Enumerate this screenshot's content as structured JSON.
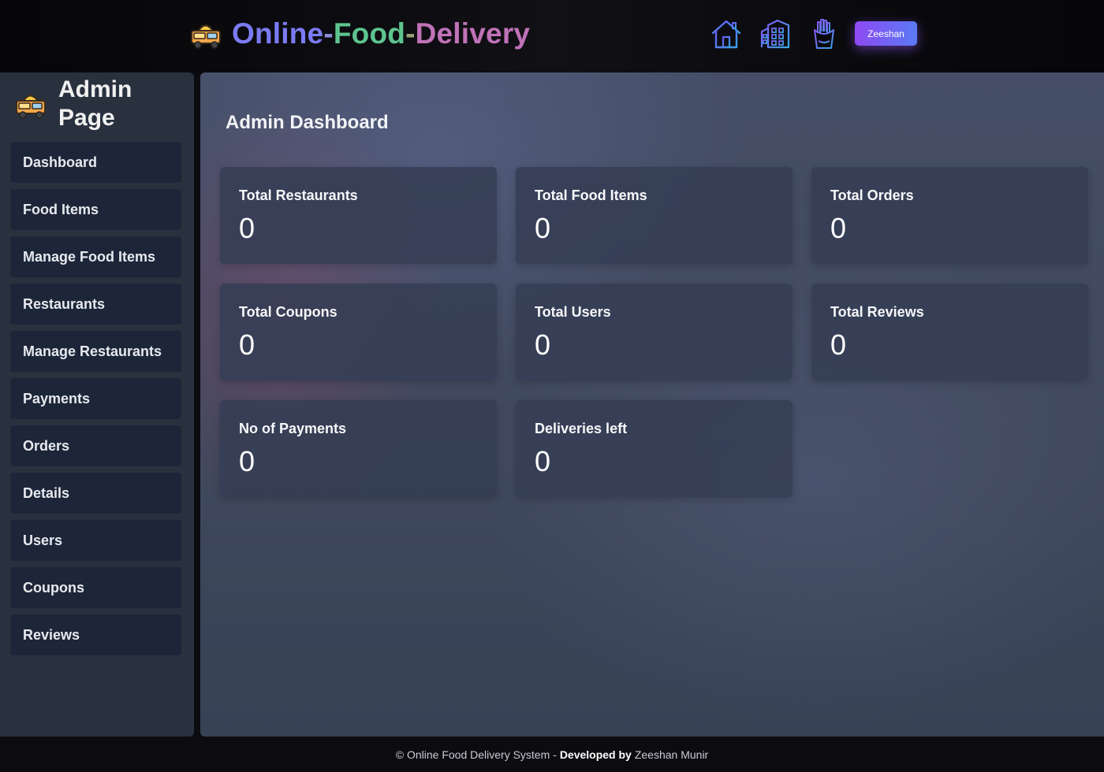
{
  "header": {
    "brand_part1": "Online",
    "brand_dash1": "-",
    "brand_part2": "Food",
    "brand_dash2": "-",
    "brand_part3": "Delivery",
    "nav_icons": [
      "home-icon",
      "restaurants-building-icon",
      "fries-food-icon"
    ],
    "user_button": "Zeeshan"
  },
  "sidebar": {
    "title": "Admin Page",
    "items": [
      {
        "label": "Dashboard"
      },
      {
        "label": "Food Items"
      },
      {
        "label": "Manage Food Items"
      },
      {
        "label": "Restaurants"
      },
      {
        "label": "Manage Restaurants"
      },
      {
        "label": "Payments"
      },
      {
        "label": "Orders"
      },
      {
        "label": "Details"
      },
      {
        "label": "Users"
      },
      {
        "label": "Coupons"
      },
      {
        "label": "Reviews"
      }
    ]
  },
  "main": {
    "title": "Admin Dashboard",
    "cards": [
      {
        "label": "Total Restaurants",
        "value": "0"
      },
      {
        "label": "Total Food Items",
        "value": "0"
      },
      {
        "label": "Total Orders",
        "value": "0"
      },
      {
        "label": "Total Coupons",
        "value": "0"
      },
      {
        "label": "Total Users",
        "value": "0"
      },
      {
        "label": "Total Reviews",
        "value": "0"
      },
      {
        "label": "No of Payments",
        "value": "0"
      },
      {
        "label": "Deliveries left",
        "value": "0"
      }
    ]
  },
  "footer": {
    "copyright": "© Online Food Delivery System -",
    "developed_by": "Developed by",
    "author": "Zeeshan Munir"
  },
  "colors": {
    "accent_purple": "#8e4af2",
    "accent_blue": "#5a7af5",
    "sidebar_bg": "#29313f",
    "sidebar_item_bg": "#1d2638",
    "card_bg": "#343e54"
  }
}
